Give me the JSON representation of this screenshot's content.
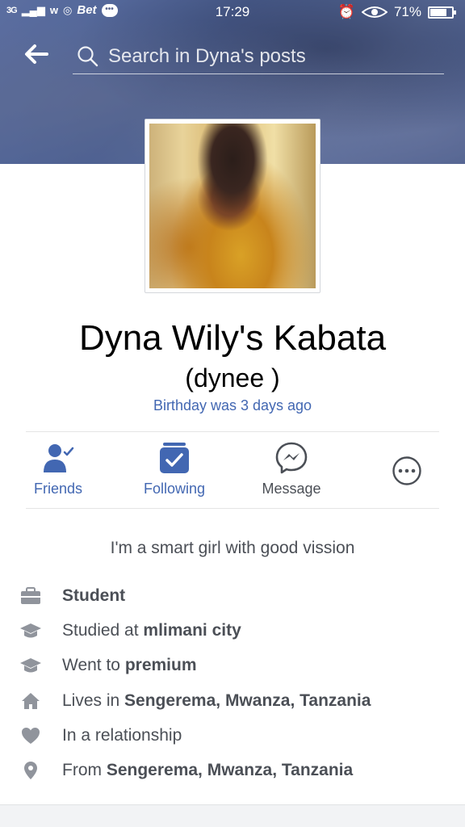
{
  "status_bar": {
    "network": "3G",
    "app_label": "Bet",
    "time": "17:29",
    "battery": "71%",
    "battery_level": 0.71
  },
  "top_bar": {
    "search_placeholder": "Search in Dyna's posts"
  },
  "profile": {
    "name": "Dyna Wily's Kabata",
    "nickname": "(dynee )",
    "birthday": "Birthday was 3 days ago"
  },
  "actions": {
    "friends": "Friends",
    "following": "Following",
    "message": "Message"
  },
  "bio": "I'm a smart girl with good vission",
  "intro": {
    "work": {
      "value": "Student"
    },
    "studied": {
      "prefix": "Studied at ",
      "value": "mlimani city"
    },
    "went": {
      "prefix": "Went to ",
      "value": "premium"
    },
    "lives": {
      "prefix": "Lives in ",
      "value": "Sengerema, Mwanza, Tanzania"
    },
    "relationship": {
      "text": "In a relationship"
    },
    "from": {
      "prefix": "From ",
      "value": "Sengerema, Mwanza, Tanzania"
    }
  },
  "colors": {
    "accent": "#4267b2",
    "text_secondary": "#4b4f56",
    "icon_gray": "#90949c"
  }
}
